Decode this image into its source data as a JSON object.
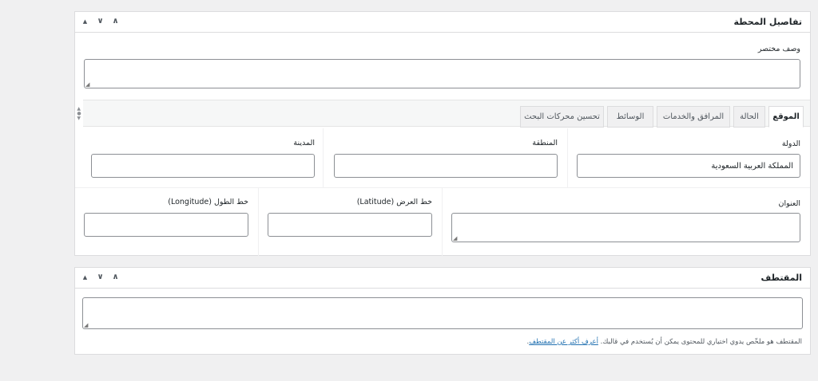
{
  "station_box": {
    "title": "تفاصيل المحطة",
    "short_description_label": "وصف مختصر",
    "tabs": [
      "الموقع",
      "الحالة",
      "المرافق والخدمات",
      "الوسائط",
      "تحسين محركات البحث"
    ],
    "country_label": "الدولة",
    "country_value": "المملكة العربية السعودية",
    "region_label": "المنطقة",
    "city_label": "المدينة",
    "address_label": "العنوان",
    "latitude_label": "خط العرض (Latitude)",
    "longitude_label": "خط الطول (Longitude)"
  },
  "excerpt_box": {
    "title": "المقتطف",
    "help_text": "المقتطف هو ملخّص يدوي اختياري للمحتوى يمكن أن يُستخدم في قالبك.",
    "help_link": "أعرف أكثر عن المقتطف"
  },
  "controls": {
    "move_up": "▲",
    "move_down": "∨",
    "collapse": "∧"
  }
}
